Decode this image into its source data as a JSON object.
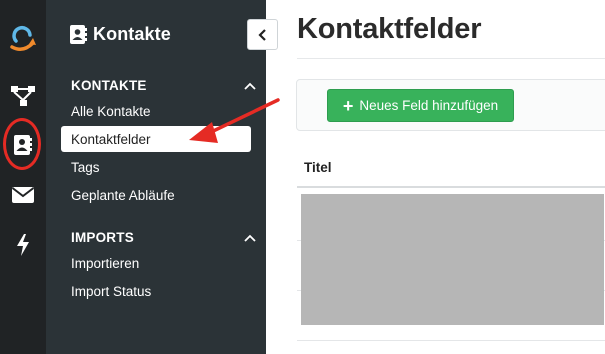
{
  "sidebar": {
    "title": "Kontakte",
    "sections": [
      {
        "heading": "KONTAKTE",
        "items": [
          "Alle Kontakte",
          "Kontaktfelder",
          "Tags",
          "Geplante Abläufe"
        ]
      },
      {
        "heading": "IMPORTS",
        "items": [
          "Importieren",
          "Import Status"
        ]
      }
    ],
    "active_item": "Kontaktfelder"
  },
  "rail": {
    "icons": [
      "logo-icon",
      "workflow-icon",
      "contacts-icon",
      "mail-icon",
      "bolt-icon"
    ],
    "active_icon": "contacts-icon"
  },
  "main": {
    "title": "Kontaktfelder",
    "add_button_label": "Neues Feld hinzufügen",
    "table": {
      "columns": [
        "Titel"
      ]
    }
  },
  "colors": {
    "accent_green": "#38b25b",
    "annotation_red": "#e52b24",
    "sidebar_bg": "#2b3337",
    "rail_bg": "#202325"
  }
}
